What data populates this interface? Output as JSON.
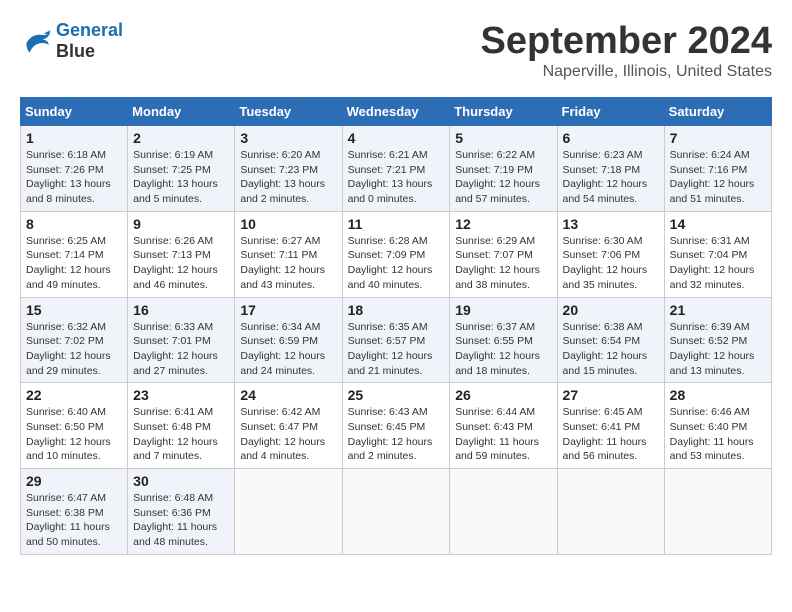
{
  "header": {
    "logo_line1": "General",
    "logo_line2": "Blue",
    "month": "September 2024",
    "location": "Naperville, Illinois, United States"
  },
  "weekdays": [
    "Sunday",
    "Monday",
    "Tuesday",
    "Wednesday",
    "Thursday",
    "Friday",
    "Saturday"
  ],
  "weeks": [
    [
      {
        "day": "1",
        "info": "Sunrise: 6:18 AM\nSunset: 7:26 PM\nDaylight: 13 hours\nand 8 minutes."
      },
      {
        "day": "2",
        "info": "Sunrise: 6:19 AM\nSunset: 7:25 PM\nDaylight: 13 hours\nand 5 minutes."
      },
      {
        "day": "3",
        "info": "Sunrise: 6:20 AM\nSunset: 7:23 PM\nDaylight: 13 hours\nand 2 minutes."
      },
      {
        "day": "4",
        "info": "Sunrise: 6:21 AM\nSunset: 7:21 PM\nDaylight: 13 hours\nand 0 minutes."
      },
      {
        "day": "5",
        "info": "Sunrise: 6:22 AM\nSunset: 7:19 PM\nDaylight: 12 hours\nand 57 minutes."
      },
      {
        "day": "6",
        "info": "Sunrise: 6:23 AM\nSunset: 7:18 PM\nDaylight: 12 hours\nand 54 minutes."
      },
      {
        "day": "7",
        "info": "Sunrise: 6:24 AM\nSunset: 7:16 PM\nDaylight: 12 hours\nand 51 minutes."
      }
    ],
    [
      {
        "day": "8",
        "info": "Sunrise: 6:25 AM\nSunset: 7:14 PM\nDaylight: 12 hours\nand 49 minutes."
      },
      {
        "day": "9",
        "info": "Sunrise: 6:26 AM\nSunset: 7:13 PM\nDaylight: 12 hours\nand 46 minutes."
      },
      {
        "day": "10",
        "info": "Sunrise: 6:27 AM\nSunset: 7:11 PM\nDaylight: 12 hours\nand 43 minutes."
      },
      {
        "day": "11",
        "info": "Sunrise: 6:28 AM\nSunset: 7:09 PM\nDaylight: 12 hours\nand 40 minutes."
      },
      {
        "day": "12",
        "info": "Sunrise: 6:29 AM\nSunset: 7:07 PM\nDaylight: 12 hours\nand 38 minutes."
      },
      {
        "day": "13",
        "info": "Sunrise: 6:30 AM\nSunset: 7:06 PM\nDaylight: 12 hours\nand 35 minutes."
      },
      {
        "day": "14",
        "info": "Sunrise: 6:31 AM\nSunset: 7:04 PM\nDaylight: 12 hours\nand 32 minutes."
      }
    ],
    [
      {
        "day": "15",
        "info": "Sunrise: 6:32 AM\nSunset: 7:02 PM\nDaylight: 12 hours\nand 29 minutes."
      },
      {
        "day": "16",
        "info": "Sunrise: 6:33 AM\nSunset: 7:01 PM\nDaylight: 12 hours\nand 27 minutes."
      },
      {
        "day": "17",
        "info": "Sunrise: 6:34 AM\nSunset: 6:59 PM\nDaylight: 12 hours\nand 24 minutes."
      },
      {
        "day": "18",
        "info": "Sunrise: 6:35 AM\nSunset: 6:57 PM\nDaylight: 12 hours\nand 21 minutes."
      },
      {
        "day": "19",
        "info": "Sunrise: 6:37 AM\nSunset: 6:55 PM\nDaylight: 12 hours\nand 18 minutes."
      },
      {
        "day": "20",
        "info": "Sunrise: 6:38 AM\nSunset: 6:54 PM\nDaylight: 12 hours\nand 15 minutes."
      },
      {
        "day": "21",
        "info": "Sunrise: 6:39 AM\nSunset: 6:52 PM\nDaylight: 12 hours\nand 13 minutes."
      }
    ],
    [
      {
        "day": "22",
        "info": "Sunrise: 6:40 AM\nSunset: 6:50 PM\nDaylight: 12 hours\nand 10 minutes."
      },
      {
        "day": "23",
        "info": "Sunrise: 6:41 AM\nSunset: 6:48 PM\nDaylight: 12 hours\nand 7 minutes."
      },
      {
        "day": "24",
        "info": "Sunrise: 6:42 AM\nSunset: 6:47 PM\nDaylight: 12 hours\nand 4 minutes."
      },
      {
        "day": "25",
        "info": "Sunrise: 6:43 AM\nSunset: 6:45 PM\nDaylight: 12 hours\nand 2 minutes."
      },
      {
        "day": "26",
        "info": "Sunrise: 6:44 AM\nSunset: 6:43 PM\nDaylight: 11 hours\nand 59 minutes."
      },
      {
        "day": "27",
        "info": "Sunrise: 6:45 AM\nSunset: 6:41 PM\nDaylight: 11 hours\nand 56 minutes."
      },
      {
        "day": "28",
        "info": "Sunrise: 6:46 AM\nSunset: 6:40 PM\nDaylight: 11 hours\nand 53 minutes."
      }
    ],
    [
      {
        "day": "29",
        "info": "Sunrise: 6:47 AM\nSunset: 6:38 PM\nDaylight: 11 hours\nand 50 minutes."
      },
      {
        "day": "30",
        "info": "Sunrise: 6:48 AM\nSunset: 6:36 PM\nDaylight: 11 hours\nand 48 minutes."
      },
      {
        "day": "",
        "info": ""
      },
      {
        "day": "",
        "info": ""
      },
      {
        "day": "",
        "info": ""
      },
      {
        "day": "",
        "info": ""
      },
      {
        "day": "",
        "info": ""
      }
    ]
  ]
}
